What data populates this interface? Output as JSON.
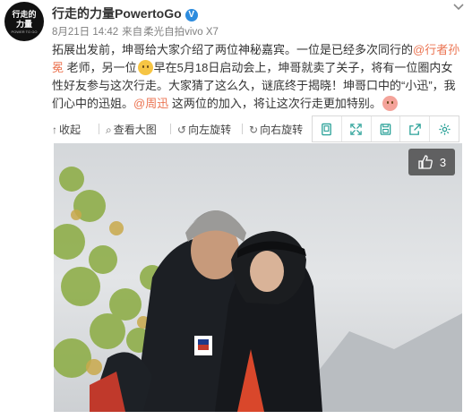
{
  "header": {
    "avatar": {
      "line1": "行走的",
      "line2": "力量",
      "line3": "POWER TO GO"
    },
    "username": "行走的力量PowertoGo",
    "verified_badge": "V",
    "date": "8月21日 14:42",
    "source_prefix": "来自",
    "source": "柔光自拍vivo X7",
    "more_icon": "chevron-down-icon"
  },
  "post": {
    "segments": {
      "s1": "拓展出发前，坤哥给大家介绍了两位神秘嘉宾。一位是已经多次同行的",
      "mention1": "@行者孙冕",
      "s2": " 老师，另一位",
      "emoji1": "doge-emoji",
      "s3": "早在5月18日启动会上，坤哥就卖了关子，将有一位圈内女性好友参与这次行走。大家猜了这么久，谜底终于揭晓！坤哥口中的“小迅”，我们心中的迅姐。",
      "mention2": "@周迅",
      "s4": " 这两位的加入，将让这次行走更加特别。",
      "emoji2": "pig-emoji"
    }
  },
  "toolbar": {
    "collapse": "收起",
    "view_large": "查看大图",
    "rotate_left": "向左旋转",
    "rotate_right": "向右旋转",
    "icons": [
      "image-frame-icon",
      "fullscreen-icon",
      "save-icon",
      "share-icon",
      "settings-icon"
    ],
    "accent_color": "#2aa198"
  },
  "photo": {
    "like_icon": "thumbs-up-icon",
    "like_count": "3"
  }
}
